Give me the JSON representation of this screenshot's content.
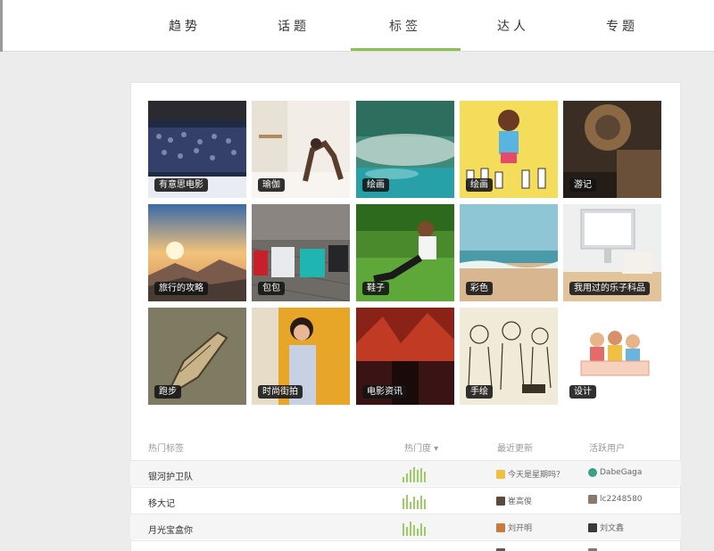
{
  "nav": {
    "tabs": [
      {
        "label": "趋势"
      },
      {
        "label": "话题"
      },
      {
        "label": "标签",
        "active": true
      },
      {
        "label": "达人"
      },
      {
        "label": "专题"
      }
    ],
    "accent": "#8cc152"
  },
  "tags": [
    {
      "label": "有意思电影"
    },
    {
      "label": "瑜伽"
    },
    {
      "label": "绘画"
    },
    {
      "label": "绘画"
    },
    {
      "label": "游记"
    },
    {
      "label": "旅行的攻略"
    },
    {
      "label": "包包"
    },
    {
      "label": "鞋子"
    },
    {
      "label": "彩色"
    },
    {
      "label": "我用过的乐子科品"
    },
    {
      "label": "跑步"
    },
    {
      "label": "时尚街拍"
    },
    {
      "label": "电影资讯"
    },
    {
      "label": "手绘"
    },
    {
      "label": "设计"
    }
  ],
  "table": {
    "headers": {
      "tag": "热门标签",
      "heat": "热门度 ▾",
      "update": "最近更新",
      "user": "活跃用户"
    },
    "rows": [
      {
        "tag": "银河护卫队",
        "update": "今天是星期吗？",
        "user": "DabeGaga"
      },
      {
        "tag": "移大记",
        "update": "崔高俊",
        "user": "lc2248580"
      },
      {
        "tag": "月光宝盒你",
        "update": "刘开明",
        "user": "刘文鑫"
      },
      {
        "tag": "旧时",
        "update": "",
        "user": ""
      }
    ]
  }
}
